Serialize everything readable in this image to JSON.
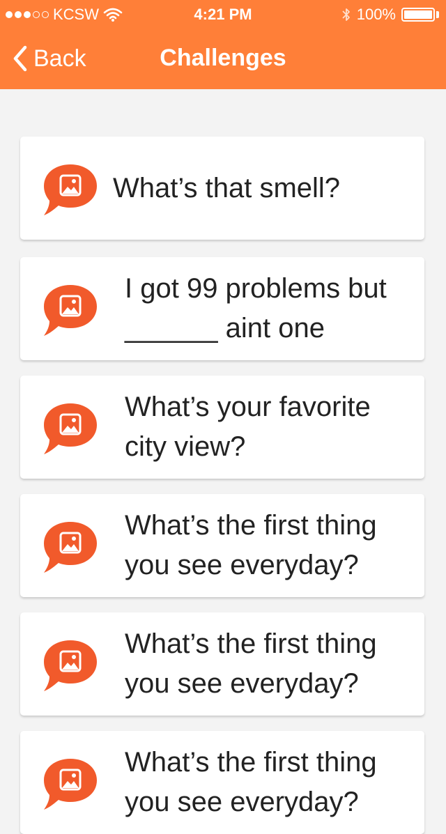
{
  "status_bar": {
    "carrier": "KCSW",
    "time": "4:21 PM",
    "battery_percent": "100%",
    "signal_bars_filled": 3,
    "signal_bars_total": 5
  },
  "nav": {
    "back_label": "Back",
    "title": "Challenges"
  },
  "colors": {
    "accent": "#ff7f38",
    "icon": "#f15a2b",
    "background": "#f3f3f3",
    "card": "#ffffff"
  },
  "challenges": [
    {
      "text": "What’s that smell?",
      "icon": "photo-chat-icon"
    },
    {
      "text": "I got 99 problems but ______ aint one",
      "icon": "photo-chat-icon"
    },
    {
      "text": "What’s your favorite city view?",
      "icon": "photo-chat-icon"
    },
    {
      "text": "What’s the first thing you see everyday?",
      "icon": "photo-chat-icon"
    },
    {
      "text": "What’s the first thing you see everyday?",
      "icon": "photo-chat-icon"
    },
    {
      "text": "What’s the first thing you see everyday?",
      "icon": "photo-chat-icon"
    }
  ]
}
